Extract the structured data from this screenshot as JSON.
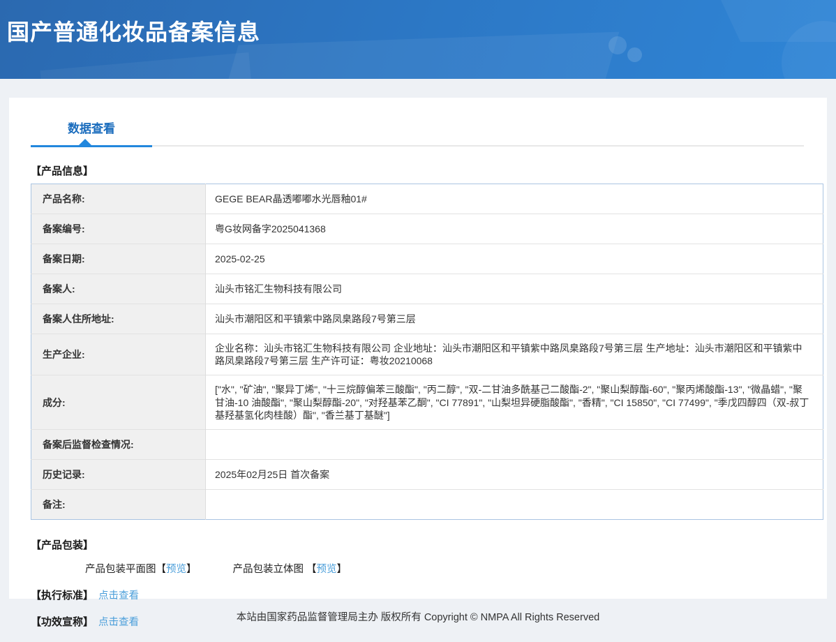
{
  "header": {
    "title": "国产普通化妆品备案信息"
  },
  "tabs": {
    "data_view": "数据查看"
  },
  "product_info": {
    "section_title": "【产品信息】",
    "rows": [
      {
        "label": "产品名称:",
        "value": "GEGE BEAR晶透嘟嘟水光唇釉01#"
      },
      {
        "label": "备案编号:",
        "value": "粤G妆网备字2025041368"
      },
      {
        "label": "备案日期:",
        "value": "2025-02-25"
      },
      {
        "label": "备案人:",
        "value": "汕头市铭汇生物科技有限公司"
      },
      {
        "label": "备案人住所地址:",
        "value": "汕头市潮阳区和平镇紫中路凤臬路段7号第三层"
      },
      {
        "label": "生产企业:",
        "value": "企业名称：汕头市铭汇生物科技有限公司 企业地址：汕头市潮阳区和平镇紫中路凤臬路段7号第三层 生产地址：汕头市潮阳区和平镇紫中路凤臬路段7号第三层 生产许可证：粤妆20210068"
      },
      {
        "label": "成分:",
        "value": "[\"水\", \"矿油\", \"聚异丁烯\", \"十三烷醇偏苯三酸酯\", \"丙二醇\", \"双-二甘油多酰基己二酸酯-2\", \"聚山梨醇酯-60\", \"聚丙烯酸酯-13\", \"微晶蜡\", \"聚甘油-10 油酸酯\", \"聚山梨醇酯-20\", \"对羟基苯乙酮\", \"CI 77891\", \"山梨坦异硬脂酸酯\", \"香精\", \"CI 15850\", \"CI 77499\", \"季戊四醇四（双-叔丁基羟基氢化肉桂酸）酯\", \"香兰基丁基醚\"]"
      },
      {
        "label": "备案后监督检查情况:",
        "value": ""
      },
      {
        "label": "历史记录:",
        "value": "2025年02月25日 首次备案"
      },
      {
        "label": "备注:",
        "value": ""
      }
    ]
  },
  "packaging": {
    "section_title": "【产品包装】",
    "items": [
      {
        "label": "产品包装平面图",
        "open": "【",
        "link": "预览",
        "close": "】"
      },
      {
        "label": "产品包装立体图 ",
        "open": "【",
        "link": "预览",
        "close": "】"
      }
    ]
  },
  "standards": {
    "label": "【执行标准】",
    "link": "点击查看"
  },
  "efficacy": {
    "label": "【功效宣称】",
    "link": "点击查看"
  },
  "footer": {
    "text": "本站由国家药品监督管理局主办 版权所有 Copyright © NMPA All Rights Reserved"
  },
  "colors": {
    "banner_gradient_start": "#2b69b0",
    "banner_gradient_end": "#2f85d6",
    "tab_text": "#1a6cbd",
    "tab_underline": "#2287dd",
    "link": "#4a9eda",
    "table_border": "#aac4e2",
    "label_cell_bg": "#f0f0f0",
    "page_bg": "#eef1f5"
  }
}
